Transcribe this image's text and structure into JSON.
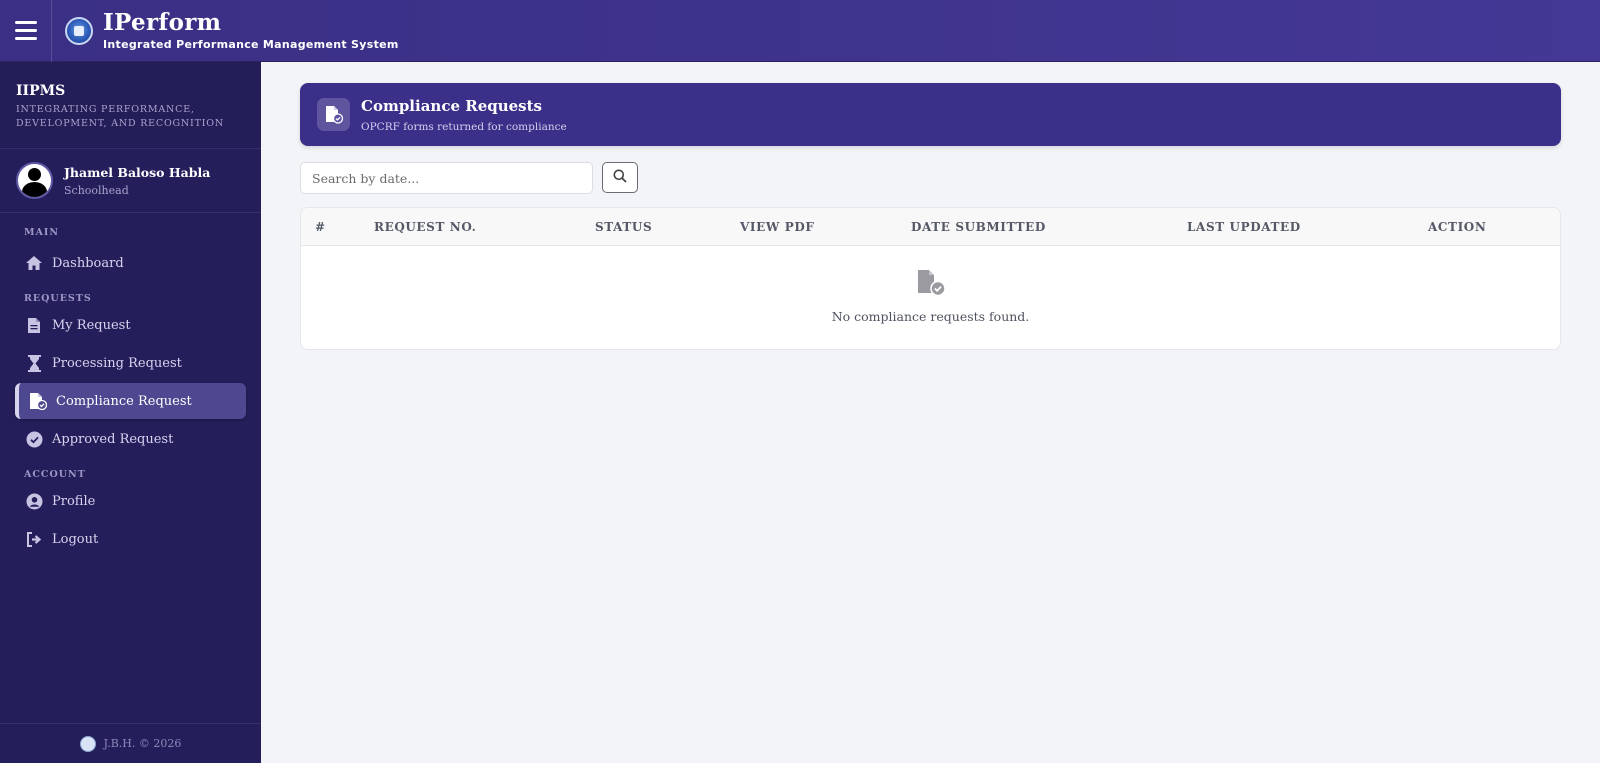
{
  "topbar": {
    "title": "IPerform",
    "subtitle": "Integrated Performance Management System"
  },
  "sidebar": {
    "app_name": "IIPMS",
    "tagline": "Integrating Performance, Development, and Recognition",
    "user": {
      "name": "Jhamel Baloso Habla",
      "role": "Schoolhead"
    },
    "sections": {
      "main": "Main",
      "requests": "Requests",
      "account": "Account"
    },
    "items": [
      {
        "label": "Dashboard",
        "icon": "home-icon"
      },
      {
        "label": "My Request",
        "icon": "file-icon"
      },
      {
        "label": "Processing Request",
        "icon": "hourglass-icon"
      },
      {
        "label": "Compliance Request",
        "icon": "file-check-icon",
        "active": true
      },
      {
        "label": "Approved Request",
        "icon": "check-circle-icon"
      },
      {
        "label": "Profile",
        "icon": "user-circle-icon"
      },
      {
        "label": "Logout",
        "icon": "logout-icon"
      }
    ],
    "footer": "J.B.H. © 2026"
  },
  "header": {
    "title": "Compliance Requests",
    "subtitle": "OPCRF forms returned for compliance"
  },
  "search": {
    "placeholder": "Search by date..."
  },
  "table": {
    "columns": [
      "#",
      "Request No.",
      "Status",
      "View PDF",
      "Date Submitted",
      "Last Updated",
      "Action"
    ],
    "empty_message": "No compliance requests found."
  },
  "colors": {
    "topbar": "#3b3089",
    "sidebar": "#241f5b",
    "accent": "#3b3089",
    "background": "#f3f4f8"
  }
}
